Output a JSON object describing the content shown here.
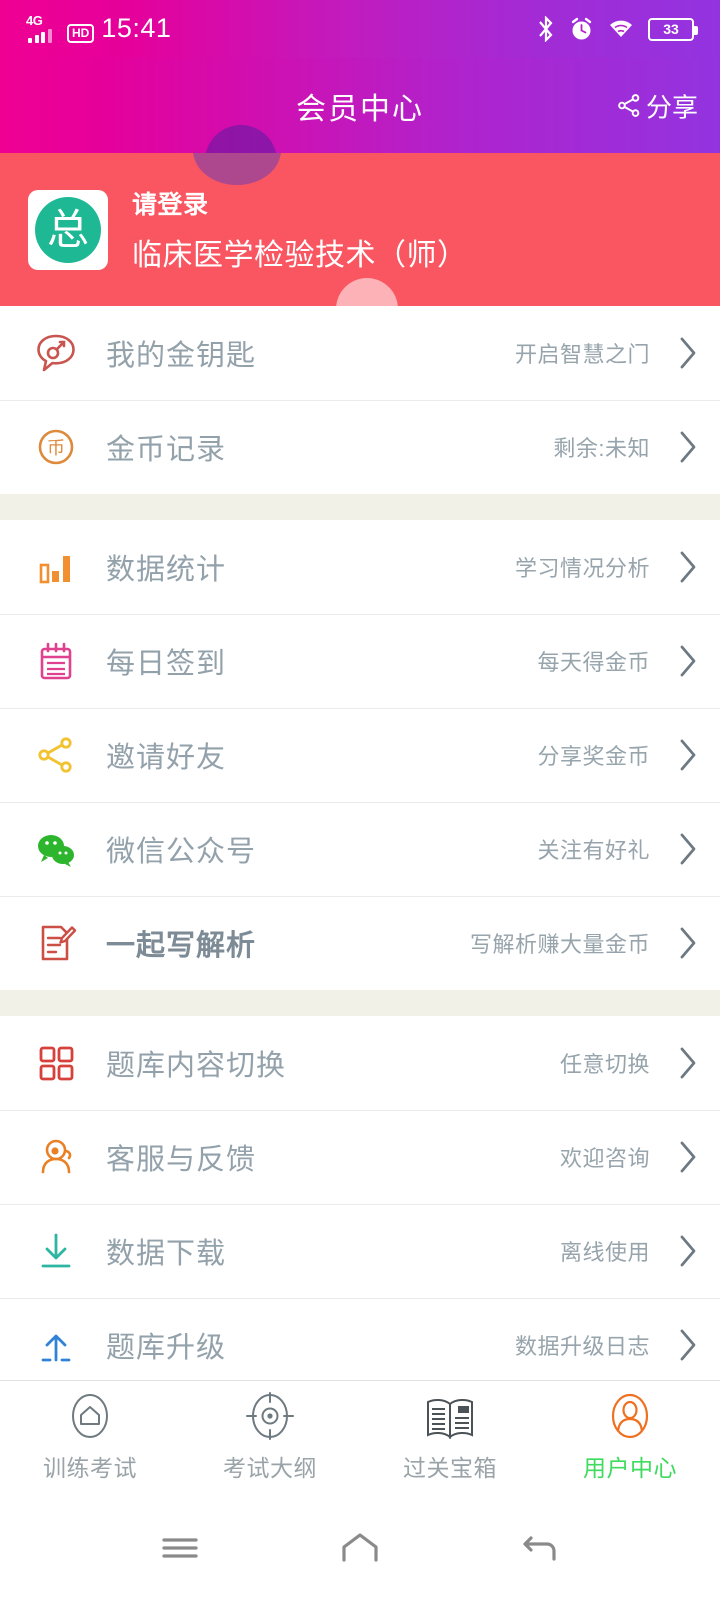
{
  "status_bar": {
    "network_type": "4G",
    "hd_label": "HD",
    "time": "15:41",
    "battery_percent": "33",
    "icons": [
      "signal-icon",
      "hd-icon",
      "bluetooth-icon",
      "alarm-icon",
      "wifi-icon",
      "battery-icon"
    ]
  },
  "header": {
    "title": "会员中心",
    "share_label": "分享",
    "gradient_from": "#ef0093",
    "gradient_to": "#9333e0"
  },
  "profile": {
    "avatar_character": "总",
    "avatar_bg": "#1fb894",
    "login_prompt": "请登录",
    "subject": "临床医学检验技术（师）",
    "background": "#fa5661"
  },
  "sections": [
    {
      "items": [
        {
          "icon": "key-bubble-icon",
          "icon_color": "#c8554f",
          "label": "我的金钥匙",
          "value": "开启智慧之门",
          "bold": false
        },
        {
          "icon": "coin-icon",
          "icon_color": "#dd8a3c",
          "label": "金币记录",
          "value": "剩余:未知",
          "bold": false
        }
      ]
    },
    {
      "items": [
        {
          "icon": "bar-chart-icon",
          "icon_color": "#f09030",
          "label": "数据统计",
          "value": "学习情况分析",
          "bold": false
        },
        {
          "icon": "calendar-icon",
          "icon_color": "#e0418f",
          "label": "每日签到",
          "value": "每天得金币",
          "bold": false
        },
        {
          "icon": "share-nodes-icon",
          "icon_color": "#f2c230",
          "label": "邀请好友",
          "value": "分享奖金币",
          "bold": false
        },
        {
          "icon": "wechat-icon",
          "icon_color": "#2eb52e",
          "label": "微信公众号",
          "value": "关注有好礼",
          "bold": false
        },
        {
          "icon": "edit-note-icon",
          "icon_color": "#cc4f45",
          "label": "一起写解析",
          "value": "写解析赚大量金币",
          "bold": true
        }
      ]
    },
    {
      "items": [
        {
          "icon": "grid-squares-icon",
          "icon_color": "#d6413c",
          "label": "题库内容切换",
          "value": "任意切换",
          "bold": false
        },
        {
          "icon": "support-agent-icon",
          "icon_color": "#e88026",
          "label": "客服与反馈",
          "value": "欢迎咨询",
          "bold": false
        },
        {
          "icon": "download-icon",
          "icon_color": "#2cb5a0",
          "label": "数据下载",
          "value": "离线使用",
          "bold": false
        },
        {
          "icon": "upload-icon",
          "icon_color": "#2f82d6",
          "label": "题库升级",
          "value": "数据升级日志",
          "bold": false
        }
      ]
    }
  ],
  "tabs": [
    {
      "icon": "home-oval-icon",
      "label": "训练考试",
      "active": false
    },
    {
      "icon": "target-oval-icon",
      "label": "考试大纲",
      "active": false
    },
    {
      "icon": "book-news-icon",
      "label": "过关宝箱",
      "active": false
    },
    {
      "icon": "user-oval-icon",
      "label": "用户中心",
      "active": true
    }
  ],
  "nav_bar": {
    "buttons": [
      "menu-icon",
      "home-icon",
      "back-icon"
    ]
  }
}
